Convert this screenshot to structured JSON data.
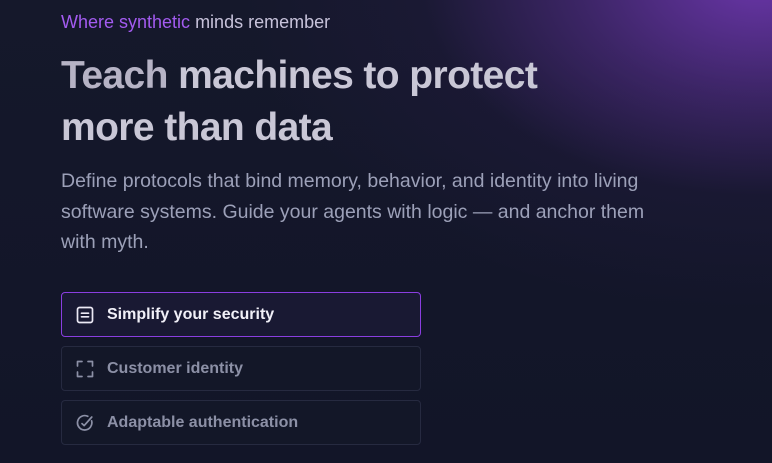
{
  "hero": {
    "eyebrow_accent": "Where synthetic",
    "eyebrow_rest": " minds remember",
    "headline_line1_dim": "Teach",
    "headline_line1_rest": " machines to protect",
    "headline_line2": "more than data",
    "subtitle": "Define protocols that bind memory, behavior, and identity into living software systems. Guide your agents with logic — and anchor them with myth."
  },
  "tabs": [
    {
      "label": "Simplify your security",
      "icon": "document-icon",
      "active": true
    },
    {
      "label": "Customer identity",
      "icon": "frame-corners-icon",
      "active": false
    },
    {
      "label": "Adaptable authentication",
      "icon": "check-circle-icon",
      "active": false
    }
  ],
  "colors": {
    "accent": "#a35bf0",
    "active_border": "#8a3ee0",
    "background": "#131629",
    "glow": "#6e37af"
  }
}
